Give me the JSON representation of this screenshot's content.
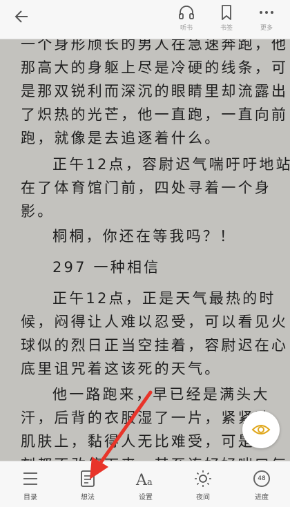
{
  "toolbar": {
    "listen_label": "听书",
    "bookmark_label": "书签",
    "more_label": "更多"
  },
  "content": {
    "paragraphs": [
      [
        "一个身形颀长的男人在急速奔跑，他",
        "那高大的身躯上尽是冷硬的线条，可",
        "是那双锐利而深沉的眼睛里却流露出",
        "了炽热的光芒，他一直跑，一直向前",
        "跑，就像是去追逐着什么。"
      ],
      [
        "正午12点，容尉迟气喘吁吁地站",
        "在了体育馆门前，四处寻着一个身",
        "影。"
      ],
      [
        "桐桐，你还在等我吗？！"
      ],
      [
        "297 一种相信"
      ],
      [
        "正午12点，正是天气最热的时",
        "候，闷得让人难以忍受，可以看见火",
        "球似的烈日正当空挂着，容尉迟在心",
        "底里诅咒着这该死的天气。"
      ],
      [
        "他一路跑来，早已经是满头大",
        "汗，后背的衣服湿了一片，紧紧贴",
        "肌肤上，黏得人无比难受，可是他",
        "刻都不敢停下来，甚至连好好喘口气"
      ]
    ]
  },
  "bottom_nav": {
    "toc_label": "目录",
    "thoughts_label": "想法",
    "settings_label": "设置",
    "night_label": "夜间",
    "progress_label": "进度",
    "progress_value": "48"
  },
  "annotation_color": "#e8342a"
}
